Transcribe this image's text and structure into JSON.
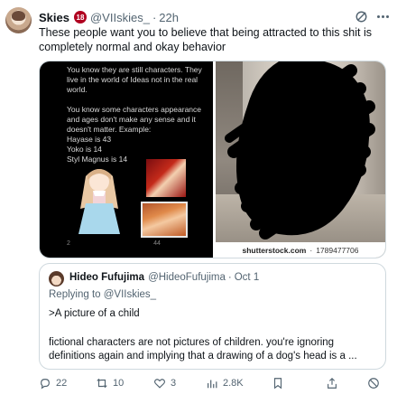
{
  "tweet": {
    "display_name": "Skies",
    "age_badge": "18",
    "handle": "@VIIskies_",
    "separator": "·",
    "time": "22h",
    "text": "These people want you to believe that being attracted to this shit is completely normal and okay behavior"
  },
  "media": {
    "screenshot": {
      "para1": [
        "You know they are still characters.  They",
        "live in the world of Ideas not in the real",
        "world."
      ],
      "para2": [
        "You know some characters appearance",
        "and ages don't make any sense and it",
        "doesn't matter. Example:",
        "Hayase is 43",
        "Yoko is 14",
        "Styl Magnus is 14"
      ],
      "mini_stats": [
        "2",
        "",
        "44",
        ""
      ]
    },
    "watermark_brand": "shutterstock.com",
    "watermark_sep": "·",
    "watermark_id": "1789477706"
  },
  "quote": {
    "display_name": "Hideo Fufujima",
    "handle": "@HideoFufujima",
    "separator": "·",
    "time": "Oct 1",
    "replying_prefix": "Replying to ",
    "replying_handle": "@VIIskies_",
    "line1": ">A picture of a child",
    "body": "fictional characters are not pictures of children. you're ignoring definitions again and implying that a drawing of a dog's head is a ..."
  },
  "actions": {
    "replies": "22",
    "reposts": "10",
    "likes": "3",
    "views": "2.8K"
  },
  "colors": {
    "text": "#0f1419",
    "secondary": "#536471",
    "border": "#cfd9de",
    "badge": "#b00020"
  },
  "icons": [
    "grok-icon",
    "more-icon",
    "reply-icon",
    "repost-icon",
    "like-icon",
    "views-icon",
    "bookmark-icon",
    "share-icon",
    "block-icon"
  ]
}
